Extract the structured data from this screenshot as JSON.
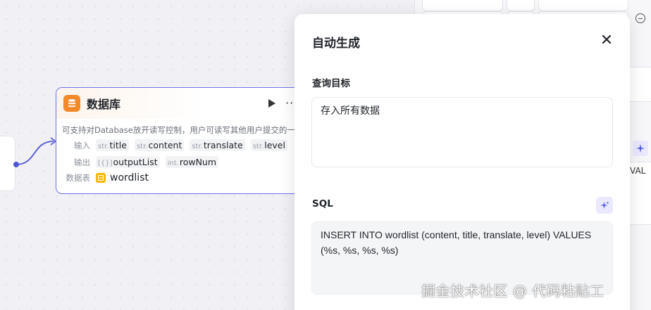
{
  "db_node": {
    "title": "数据库",
    "description": "可支持对Database放开读写控制，用户可读写其他用户提交的一",
    "input_label": "输入",
    "inputs": [
      {
        "type": "str.",
        "name": "title"
      },
      {
        "type": "str.",
        "name": "content"
      },
      {
        "type": "str.",
        "name": "translate"
      },
      {
        "type": "str.",
        "name": "level"
      }
    ],
    "output_label": "输出",
    "outputs": [
      {
        "type": "[{}]",
        "name": "outputList"
      },
      {
        "type": "int.",
        "name": "rowNum"
      }
    ],
    "table_label": "数据表",
    "table_name": "wordlist"
  },
  "right_panel": {
    "val_text": "VAL"
  },
  "dialog": {
    "title": "自动生成",
    "query_label": "查询目标",
    "query_value": "存入所有数据",
    "sql_label": "SQL",
    "sql_value": "INSERT INTO wordlist (content, title, translate, level) VALUES (%s, %s, %s, %s)"
  },
  "watermark": "掘金技术社区 @ 代码粘贴工",
  "colors": {
    "accent": "#6d72e8",
    "db_icon": "#f28a2a",
    "table_icon": "#f5b800"
  },
  "icons": [
    "database-icon",
    "run-icon",
    "more-icon",
    "table-icon",
    "close-icon",
    "sparkle-icon",
    "minus-circle-icon"
  ]
}
